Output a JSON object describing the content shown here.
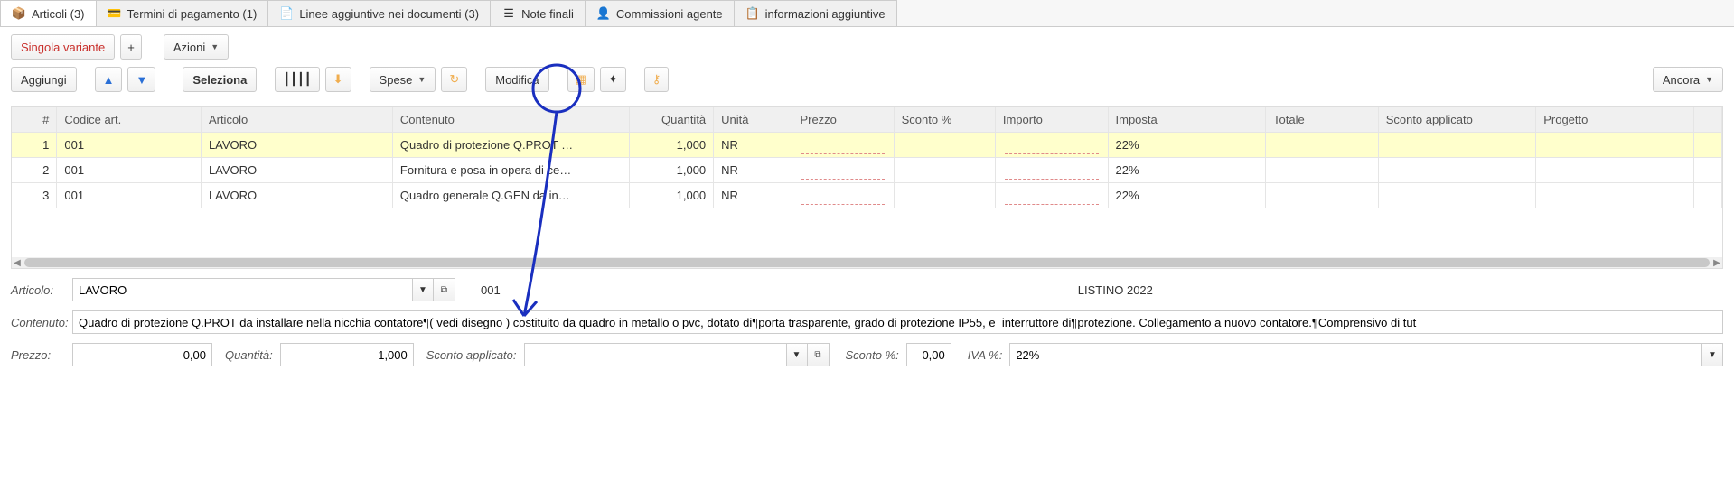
{
  "tabs": [
    {
      "icon": "📦",
      "label": "Articoli (3)"
    },
    {
      "icon": "💳",
      "label": "Termini di pagamento (1)"
    },
    {
      "icon": "📄",
      "label": "Linee aggiuntive nei documenti (3)"
    },
    {
      "icon": "☰",
      "label": "Note finali"
    },
    {
      "icon": "👤",
      "label": "Commissioni agente"
    },
    {
      "icon": "📋",
      "label": "informazioni aggiuntive"
    }
  ],
  "toolbar": {
    "singola_variante": "Singola variante",
    "plus": "+",
    "azioni": "Azioni",
    "aggiungi": "Aggiungi",
    "seleziona": "Seleziona",
    "spese": "Spese",
    "modifica": "Modifica",
    "ancora": "Ancora"
  },
  "columns": {
    "idx": "#",
    "code": "Codice art.",
    "art": "Articolo",
    "cont": "Contenuto",
    "qty": "Quantità",
    "unit": "Unità",
    "price": "Prezzo",
    "disc": "Sconto %",
    "amt": "Importo",
    "tax": "Imposta",
    "tot": "Totale",
    "discapp": "Sconto applicato",
    "proj": "Progetto"
  },
  "rows": [
    {
      "idx": "1",
      "code": "001",
      "art": "LAVORO",
      "cont": "Quadro di protezione Q.PROT …",
      "qty": "1,000",
      "unit": "NR",
      "tax": "22%"
    },
    {
      "idx": "2",
      "code": "001",
      "art": "LAVORO",
      "cont": "Fornitura e posa in opera di ce…",
      "qty": "1,000",
      "unit": "NR",
      "tax": "22%"
    },
    {
      "idx": "3",
      "code": "001",
      "art": "LAVORO",
      "cont": "Quadro generale Q.GEN da in…",
      "qty": "1,000",
      "unit": "NR",
      "tax": "22%"
    }
  ],
  "detail": {
    "articolo_label": "Articolo:",
    "articolo_value": "LAVORO",
    "articolo_code": "001",
    "listino": "LISTINO 2022",
    "contenuto_label": "Contenuto:",
    "contenuto_value": "Quadro di protezione Q.PROT da installare nella nicchia contatore¶( vedi disegno ) costituito da quadro in metallo o pvc, dotato di¶porta trasparente, grado di protezione IP55, e  interruttore di¶protezione. Collegamento a nuovo contatore.¶Comprensivo di tut",
    "prezzo_label": "Prezzo:",
    "prezzo_value": "0,00",
    "quantita_label": "Quantità:",
    "quantita_value": "1,000",
    "sconto_app_label": "Sconto applicato:",
    "sconto_pct_label": "Sconto %:",
    "sconto_pct_value": "0,00",
    "iva_label": "IVA %:",
    "iva_value": "22%"
  }
}
